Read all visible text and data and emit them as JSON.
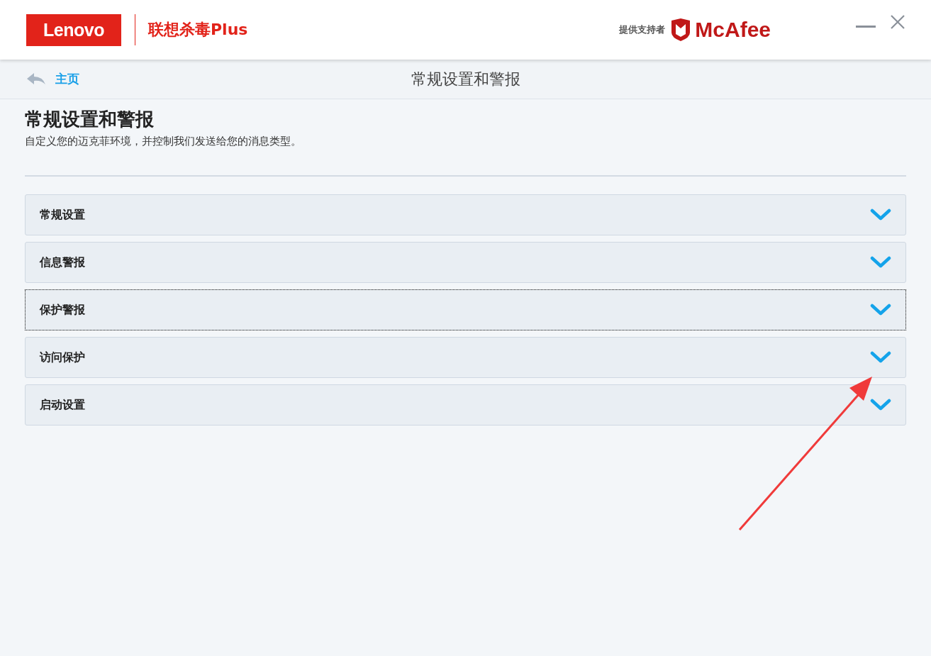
{
  "header": {
    "brand": "Lenovo",
    "product": "联想杀毒Plus",
    "powered_by": "提供支持者",
    "partner": "McAfee"
  },
  "nav": {
    "back_label": "主页",
    "title": "常规设置和警报"
  },
  "page": {
    "heading": "常规设置和警报",
    "description": "自定义您的迈克菲环境，并控制我们发送给您的消息类型。"
  },
  "sections": [
    {
      "label": "常规设置",
      "focused": false,
      "expanded": false
    },
    {
      "label": "信息警报",
      "focused": false,
      "expanded": false
    },
    {
      "label": "保护警报",
      "focused": true,
      "expanded": false
    },
    {
      "label": "访问保护",
      "focused": false,
      "expanded": false
    },
    {
      "label": "启动设置",
      "focused": false,
      "expanded": false
    }
  ]
}
